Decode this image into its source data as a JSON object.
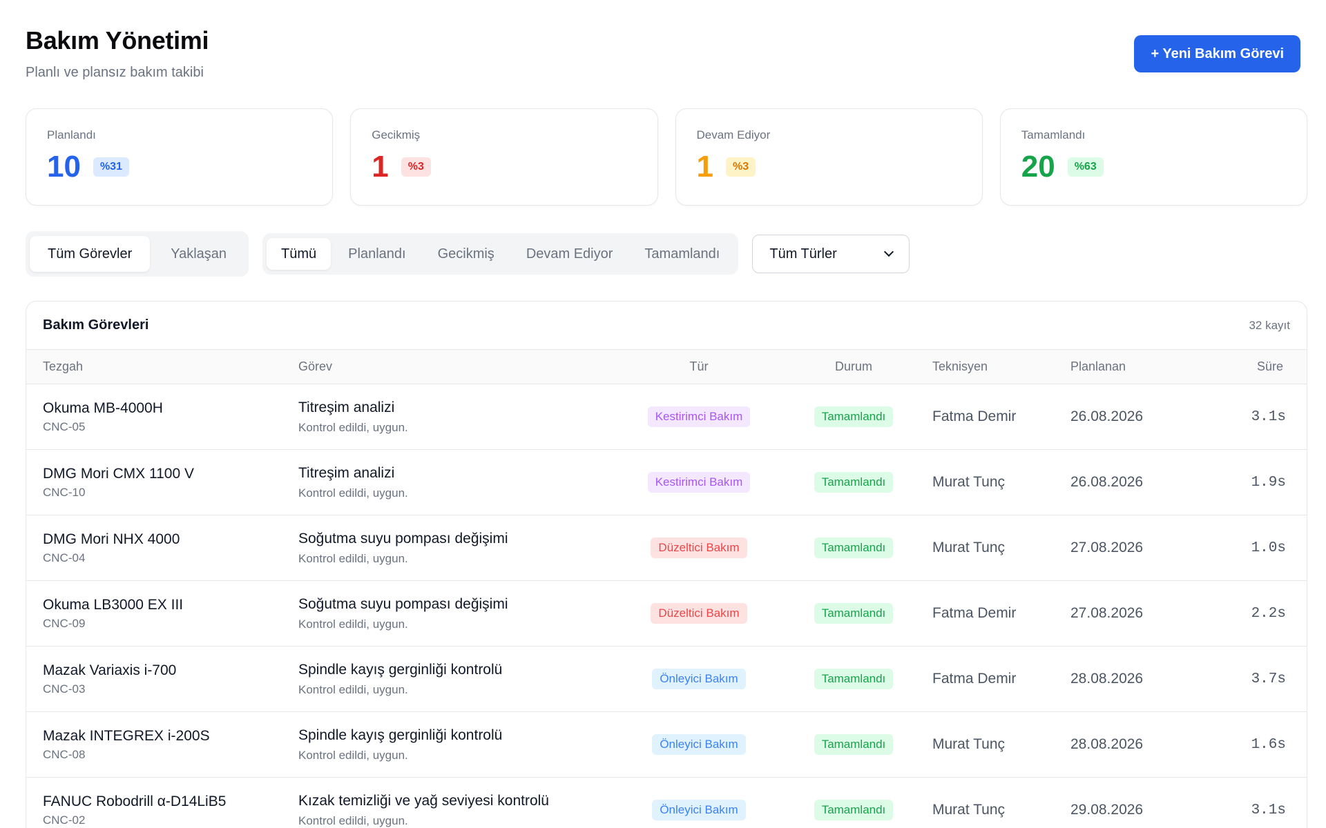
{
  "header": {
    "title": "Bakım Yönetimi",
    "subtitle": "Planlı ve plansız bakım takibi",
    "new_task_label": "+ Yeni Bakım Görevi"
  },
  "stats": [
    {
      "label": "Planlandı",
      "value": "10",
      "badge": "%31",
      "color": "#2563eb",
      "badge_bg": "#dbeafe",
      "badge_color": "#2563eb"
    },
    {
      "label": "Gecikmiş",
      "value": "1",
      "badge": "%3",
      "color": "#dc2626",
      "badge_bg": "#fee2e2",
      "badge_color": "#dc2626"
    },
    {
      "label": "Devam Ediyor",
      "value": "1",
      "badge": "%3",
      "color": "#f59e0b",
      "badge_bg": "#fef3c7",
      "badge_color": "#d97706"
    },
    {
      "label": "Tamamlandı",
      "value": "20",
      "badge": "%63",
      "color": "#16a34a",
      "badge_bg": "#dcfce7",
      "badge_color": "#16a34a"
    }
  ],
  "view_tabs": [
    {
      "label": "Tüm Görevler",
      "active": true
    },
    {
      "label": "Yaklaşan",
      "active": false
    }
  ],
  "status_tabs": [
    {
      "label": "Tümü",
      "active": true
    },
    {
      "label": "Planlandı",
      "active": false
    },
    {
      "label": "Gecikmiş",
      "active": false
    },
    {
      "label": "Devam Ediyor",
      "active": false
    },
    {
      "label": "Tamamlandı",
      "active": false
    }
  ],
  "type_filter": {
    "selected": "Tüm Türler"
  },
  "table": {
    "title": "Bakım Görevleri",
    "count": "32 kayıt",
    "columns": [
      "Tezgah",
      "Görev",
      "Tür",
      "Durum",
      "Teknisyen",
      "Planlanan",
      "Süre"
    ],
    "type_styles": {
      "Kestirimci Bakım": {
        "bg": "#f3e8ff",
        "color": "#a855f7"
      },
      "Düzeltici Bakım": {
        "bg": "#fee2e2",
        "color": "#ef4444"
      },
      "Önleyici Bakım": {
        "bg": "#e0f2fe",
        "color": "#3b82f6"
      }
    },
    "status_style": {
      "bg": "#dcfce7",
      "color": "#16a34a"
    },
    "rows": [
      {
        "machine": "Okuma MB-4000H",
        "code": "CNC-05",
        "task": "Titreşim analizi",
        "note": "Kontrol edildi, uygun.",
        "type": "Kestirimci Bakım",
        "status": "Tamamlandı",
        "tech": "Fatma Demir",
        "date": "26.08.2026",
        "duration": "3.1s"
      },
      {
        "machine": "DMG Mori CMX 1100 V",
        "code": "CNC-10",
        "task": "Titreşim analizi",
        "note": "Kontrol edildi, uygun.",
        "type": "Kestirimci Bakım",
        "status": "Tamamlandı",
        "tech": "Murat Tunç",
        "date": "26.08.2026",
        "duration": "1.9s"
      },
      {
        "machine": "DMG Mori NHX 4000",
        "code": "CNC-04",
        "task": "Soğutma suyu pompası değişimi",
        "note": "Kontrol edildi, uygun.",
        "type": "Düzeltici Bakım",
        "status": "Tamamlandı",
        "tech": "Murat Tunç",
        "date": "27.08.2026",
        "duration": "1.0s"
      },
      {
        "machine": "Okuma LB3000 EX III",
        "code": "CNC-09",
        "task": "Soğutma suyu pompası değişimi",
        "note": "Kontrol edildi, uygun.",
        "type": "Düzeltici Bakım",
        "status": "Tamamlandı",
        "tech": "Fatma Demir",
        "date": "27.08.2026",
        "duration": "2.2s"
      },
      {
        "machine": "Mazak Variaxis i-700",
        "code": "CNC-03",
        "task": "Spindle kayış gerginliği kontrolü",
        "note": "Kontrol edildi, uygun.",
        "type": "Önleyici Bakım",
        "status": "Tamamlandı",
        "tech": "Fatma Demir",
        "date": "28.08.2026",
        "duration": "3.7s"
      },
      {
        "machine": "Mazak INTEGREX i-200S",
        "code": "CNC-08",
        "task": "Spindle kayış gerginliği kontrolü",
        "note": "Kontrol edildi, uygun.",
        "type": "Önleyici Bakım",
        "status": "Tamamlandı",
        "tech": "Murat Tunç",
        "date": "28.08.2026",
        "duration": "1.6s"
      },
      {
        "machine": "FANUC Robodrill α-D14LiB5",
        "code": "CNC-02",
        "task": "Kızak temizliği ve yağ seviyesi kontrolü",
        "note": "Kontrol edildi, uygun.",
        "type": "Önleyici Bakım",
        "status": "Tamamlandı",
        "tech": "Murat Tunç",
        "date": "29.08.2026",
        "duration": "3.1s"
      }
    ]
  }
}
